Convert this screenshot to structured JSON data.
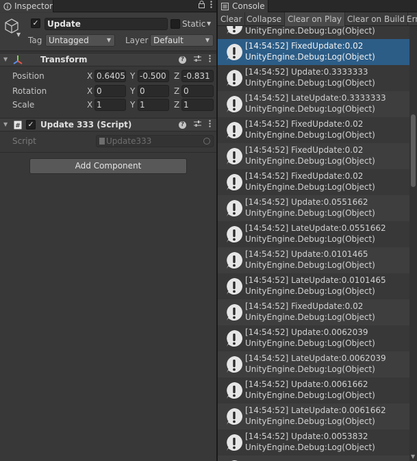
{
  "inspector": {
    "tab_label": "Inspector",
    "lock_icon": "lock-icon",
    "menu_icon": "kebab-icon",
    "object": {
      "active": true,
      "name": "Update",
      "static_label": "Static",
      "static_checked": false,
      "tag_label": "Tag",
      "tag_value": "Untagged",
      "layer_label": "Layer",
      "layer_value": "Default"
    },
    "transform": {
      "title": "Transform",
      "rows": [
        {
          "label": "Position",
          "x": "0.6405",
          "y": "-0.500",
          "z": "-0.831"
        },
        {
          "label": "Rotation",
          "x": "0",
          "y": "0",
          "z": "0"
        },
        {
          "label": "Scale",
          "x": "1",
          "y": "1",
          "z": "1"
        }
      ],
      "axes": [
        "X",
        "Y",
        "Z"
      ]
    },
    "script_component": {
      "enabled": true,
      "title": "Update 333 (Script)",
      "script_label": "Script",
      "script_value": "Update333"
    },
    "add_component_label": "Add Component"
  },
  "console": {
    "tab_label": "Console",
    "toolbar": {
      "clear": "Clear",
      "collapse": "Collapse",
      "clear_on_play": "Clear on Play",
      "clear_on_build": "Clear on Build",
      "error_pause": "Err"
    },
    "selected_index": 1,
    "entries": [
      {
        "line1": "",
        "line2": "UnityEngine.Debug:Log(Object)"
      },
      {
        "line1": "[14:54:52] FixedUpdate:0.02",
        "line2": "UnityEngine.Debug:Log(Object)"
      },
      {
        "line1": "[14:54:52] Update:0.3333333",
        "line2": "UnityEngine.Debug:Log(Object)"
      },
      {
        "line1": "[14:54:52] LateUpdate:0.3333333",
        "line2": "UnityEngine.Debug:Log(Object)"
      },
      {
        "line1": "[14:54:52] FixedUpdate:0.02",
        "line2": "UnityEngine.Debug:Log(Object)"
      },
      {
        "line1": "[14:54:52] FixedUpdate:0.02",
        "line2": "UnityEngine.Debug:Log(Object)"
      },
      {
        "line1": "[14:54:52] FixedUpdate:0.02",
        "line2": "UnityEngine.Debug:Log(Object)"
      },
      {
        "line1": "[14:54:52] Update:0.0551662",
        "line2": "UnityEngine.Debug:Log(Object)"
      },
      {
        "line1": "[14:54:52] LateUpdate:0.0551662",
        "line2": "UnityEngine.Debug:Log(Object)"
      },
      {
        "line1": "[14:54:52] Update:0.0101465",
        "line2": "UnityEngine.Debug:Log(Object)"
      },
      {
        "line1": "[14:54:52] LateUpdate:0.0101465",
        "line2": "UnityEngine.Debug:Log(Object)"
      },
      {
        "line1": "[14:54:52] FixedUpdate:0.02",
        "line2": "UnityEngine.Debug:Log(Object)"
      },
      {
        "line1": "[14:54:52] Update:0.0062039",
        "line2": "UnityEngine.Debug:Log(Object)"
      },
      {
        "line1": "[14:54:52] LateUpdate:0.0062039",
        "line2": "UnityEngine.Debug:Log(Object)"
      },
      {
        "line1": "[14:54:52] Update:0.0061662",
        "line2": "UnityEngine.Debug:Log(Object)"
      },
      {
        "line1": "[14:54:52] LateUpdate:0.0061662",
        "line2": "UnityEngine.Debug:Log(Object)"
      },
      {
        "line1": "[14:54:52] Update:0.0053832",
        "line2": "UnityEngine.Debug:Log(Object)"
      },
      {
        "line1": "",
        "line2": ""
      }
    ]
  },
  "colors": {
    "panel": "#383838",
    "selected_row": "#2c5d87",
    "warning_icon": "#e6e6e6"
  }
}
